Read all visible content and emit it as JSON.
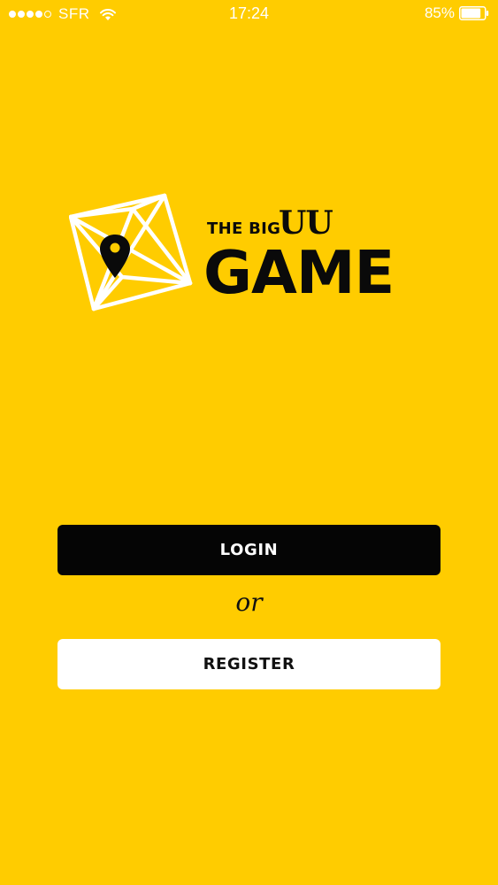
{
  "colors": {
    "background": "#FFCC00",
    "login_button": "#050505",
    "register_button": "#FFFFFF",
    "text_dark": "#0A0A0A"
  },
  "status_bar": {
    "carrier": "SFR",
    "time": "17:24",
    "battery": "85%",
    "signal_bars_filled": 4,
    "signal_bars_total": 5,
    "battery_level": 0.85,
    "icons": [
      "signal-dots-icon",
      "wifi-icon",
      "battery-icon"
    ]
  },
  "logo": {
    "line1": "THE BIG",
    "line1_serif": "UU",
    "line2": "GAME",
    "icons": [
      "polyhedron-icon",
      "map-pin-icon"
    ]
  },
  "actions": {
    "login_label": "LOGIN",
    "or_label": "or",
    "register_label": "REGISTER"
  }
}
